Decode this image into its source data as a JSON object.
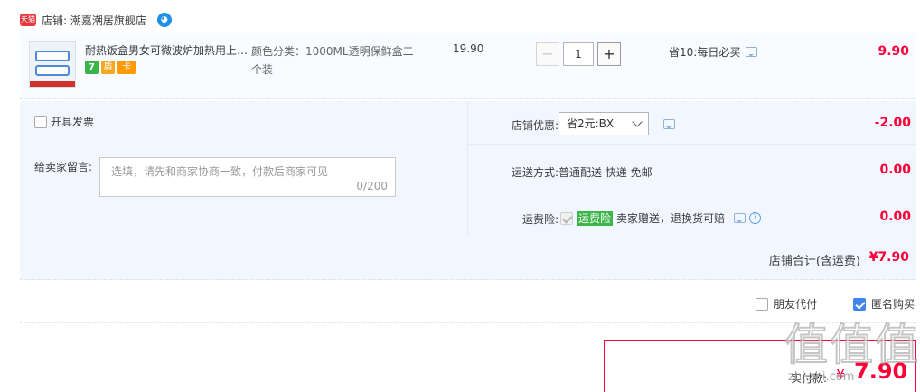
{
  "shop": {
    "badge": "天猫",
    "label": "店铺: 潮嘉潮居旗舰店"
  },
  "item": {
    "title": "耐热饭盒男女可微波炉加热用上班族",
    "badges": [
      "7",
      "盾",
      "卡"
    ],
    "spec_line1": "颜色分类：1000ML透明保鲜盒二",
    "spec_line2": "个装",
    "unit_price": "19.90",
    "quantity": "1",
    "qty_minus": "−",
    "qty_plus": "+",
    "promo": "省10:每日必买",
    "total": "9.90"
  },
  "extras": {
    "invoice_label": "开具发票",
    "message_label": "给卖家留言:",
    "message_placeholder": "选填，请先和商家协商一致，付款后商家可见",
    "message_count": "0/200",
    "coupon_label": "店铺优惠:",
    "coupon_selected": "省2元:BX",
    "coupon_value": "-2.00",
    "shipping_label": "运送方式:",
    "shipping_text": "普通配送 快递 免邮",
    "shipping_value": "0.00",
    "insurance_label": "运费险:",
    "insurance_tag": "运费险",
    "insurance_text": "卖家赠送，退换货可赔",
    "insurance_value": "0.00",
    "subtotal_label": "店铺合计(含运费)",
    "subtotal_value": "¥7.90"
  },
  "options": {
    "friend_pay": "朋友代付",
    "anonymous": "匿名购买"
  },
  "pay": {
    "label": "实付款:",
    "yen": "¥",
    "value": "7.90"
  },
  "watermark": {
    "text": "值值值",
    "url": "zhi zhi.com"
  },
  "colors": {
    "accent": "#ff0036",
    "tmall_red": "#e4393c",
    "row_bg": "#f8fbff",
    "panel_bg": "#f2f7ff",
    "checkbox_blue": "#3e86ef",
    "insurance_green": "#3bb44a"
  }
}
